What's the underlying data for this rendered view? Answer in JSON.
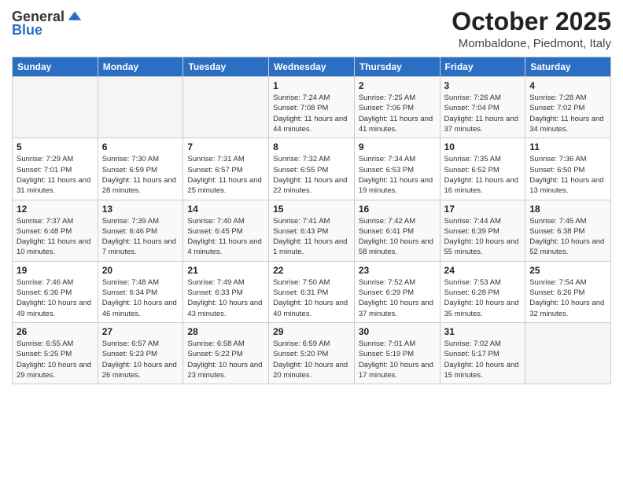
{
  "header": {
    "logo_general": "General",
    "logo_blue": "Blue",
    "month": "October 2025",
    "location": "Mombaldone, Piedmont, Italy"
  },
  "weekdays": [
    "Sunday",
    "Monday",
    "Tuesday",
    "Wednesday",
    "Thursday",
    "Friday",
    "Saturday"
  ],
  "weeks": [
    [
      {
        "day": "",
        "info": ""
      },
      {
        "day": "",
        "info": ""
      },
      {
        "day": "",
        "info": ""
      },
      {
        "day": "1",
        "info": "Sunrise: 7:24 AM\nSunset: 7:08 PM\nDaylight: 11 hours and 44 minutes."
      },
      {
        "day": "2",
        "info": "Sunrise: 7:25 AM\nSunset: 7:06 PM\nDaylight: 11 hours and 41 minutes."
      },
      {
        "day": "3",
        "info": "Sunrise: 7:26 AM\nSunset: 7:04 PM\nDaylight: 11 hours and 37 minutes."
      },
      {
        "day": "4",
        "info": "Sunrise: 7:28 AM\nSunset: 7:02 PM\nDaylight: 11 hours and 34 minutes."
      }
    ],
    [
      {
        "day": "5",
        "info": "Sunrise: 7:29 AM\nSunset: 7:01 PM\nDaylight: 11 hours and 31 minutes."
      },
      {
        "day": "6",
        "info": "Sunrise: 7:30 AM\nSunset: 6:59 PM\nDaylight: 11 hours and 28 minutes."
      },
      {
        "day": "7",
        "info": "Sunrise: 7:31 AM\nSunset: 6:57 PM\nDaylight: 11 hours and 25 minutes."
      },
      {
        "day": "8",
        "info": "Sunrise: 7:32 AM\nSunset: 6:55 PM\nDaylight: 11 hours and 22 minutes."
      },
      {
        "day": "9",
        "info": "Sunrise: 7:34 AM\nSunset: 6:53 PM\nDaylight: 11 hours and 19 minutes."
      },
      {
        "day": "10",
        "info": "Sunrise: 7:35 AM\nSunset: 6:52 PM\nDaylight: 11 hours and 16 minutes."
      },
      {
        "day": "11",
        "info": "Sunrise: 7:36 AM\nSunset: 6:50 PM\nDaylight: 11 hours and 13 minutes."
      }
    ],
    [
      {
        "day": "12",
        "info": "Sunrise: 7:37 AM\nSunset: 6:48 PM\nDaylight: 11 hours and 10 minutes."
      },
      {
        "day": "13",
        "info": "Sunrise: 7:39 AM\nSunset: 6:46 PM\nDaylight: 11 hours and 7 minutes."
      },
      {
        "day": "14",
        "info": "Sunrise: 7:40 AM\nSunset: 6:45 PM\nDaylight: 11 hours and 4 minutes."
      },
      {
        "day": "15",
        "info": "Sunrise: 7:41 AM\nSunset: 6:43 PM\nDaylight: 11 hours and 1 minute."
      },
      {
        "day": "16",
        "info": "Sunrise: 7:42 AM\nSunset: 6:41 PM\nDaylight: 10 hours and 58 minutes."
      },
      {
        "day": "17",
        "info": "Sunrise: 7:44 AM\nSunset: 6:39 PM\nDaylight: 10 hours and 55 minutes."
      },
      {
        "day": "18",
        "info": "Sunrise: 7:45 AM\nSunset: 6:38 PM\nDaylight: 10 hours and 52 minutes."
      }
    ],
    [
      {
        "day": "19",
        "info": "Sunrise: 7:46 AM\nSunset: 6:36 PM\nDaylight: 10 hours and 49 minutes."
      },
      {
        "day": "20",
        "info": "Sunrise: 7:48 AM\nSunset: 6:34 PM\nDaylight: 10 hours and 46 minutes."
      },
      {
        "day": "21",
        "info": "Sunrise: 7:49 AM\nSunset: 6:33 PM\nDaylight: 10 hours and 43 minutes."
      },
      {
        "day": "22",
        "info": "Sunrise: 7:50 AM\nSunset: 6:31 PM\nDaylight: 10 hours and 40 minutes."
      },
      {
        "day": "23",
        "info": "Sunrise: 7:52 AM\nSunset: 6:29 PM\nDaylight: 10 hours and 37 minutes."
      },
      {
        "day": "24",
        "info": "Sunrise: 7:53 AM\nSunset: 6:28 PM\nDaylight: 10 hours and 35 minutes."
      },
      {
        "day": "25",
        "info": "Sunrise: 7:54 AM\nSunset: 6:26 PM\nDaylight: 10 hours and 32 minutes."
      }
    ],
    [
      {
        "day": "26",
        "info": "Sunrise: 6:55 AM\nSunset: 5:25 PM\nDaylight: 10 hours and 29 minutes."
      },
      {
        "day": "27",
        "info": "Sunrise: 6:57 AM\nSunset: 5:23 PM\nDaylight: 10 hours and 26 minutes."
      },
      {
        "day": "28",
        "info": "Sunrise: 6:58 AM\nSunset: 5:22 PM\nDaylight: 10 hours and 23 minutes."
      },
      {
        "day": "29",
        "info": "Sunrise: 6:59 AM\nSunset: 5:20 PM\nDaylight: 10 hours and 20 minutes."
      },
      {
        "day": "30",
        "info": "Sunrise: 7:01 AM\nSunset: 5:19 PM\nDaylight: 10 hours and 17 minutes."
      },
      {
        "day": "31",
        "info": "Sunrise: 7:02 AM\nSunset: 5:17 PM\nDaylight: 10 hours and 15 minutes."
      },
      {
        "day": "",
        "info": ""
      }
    ]
  ]
}
